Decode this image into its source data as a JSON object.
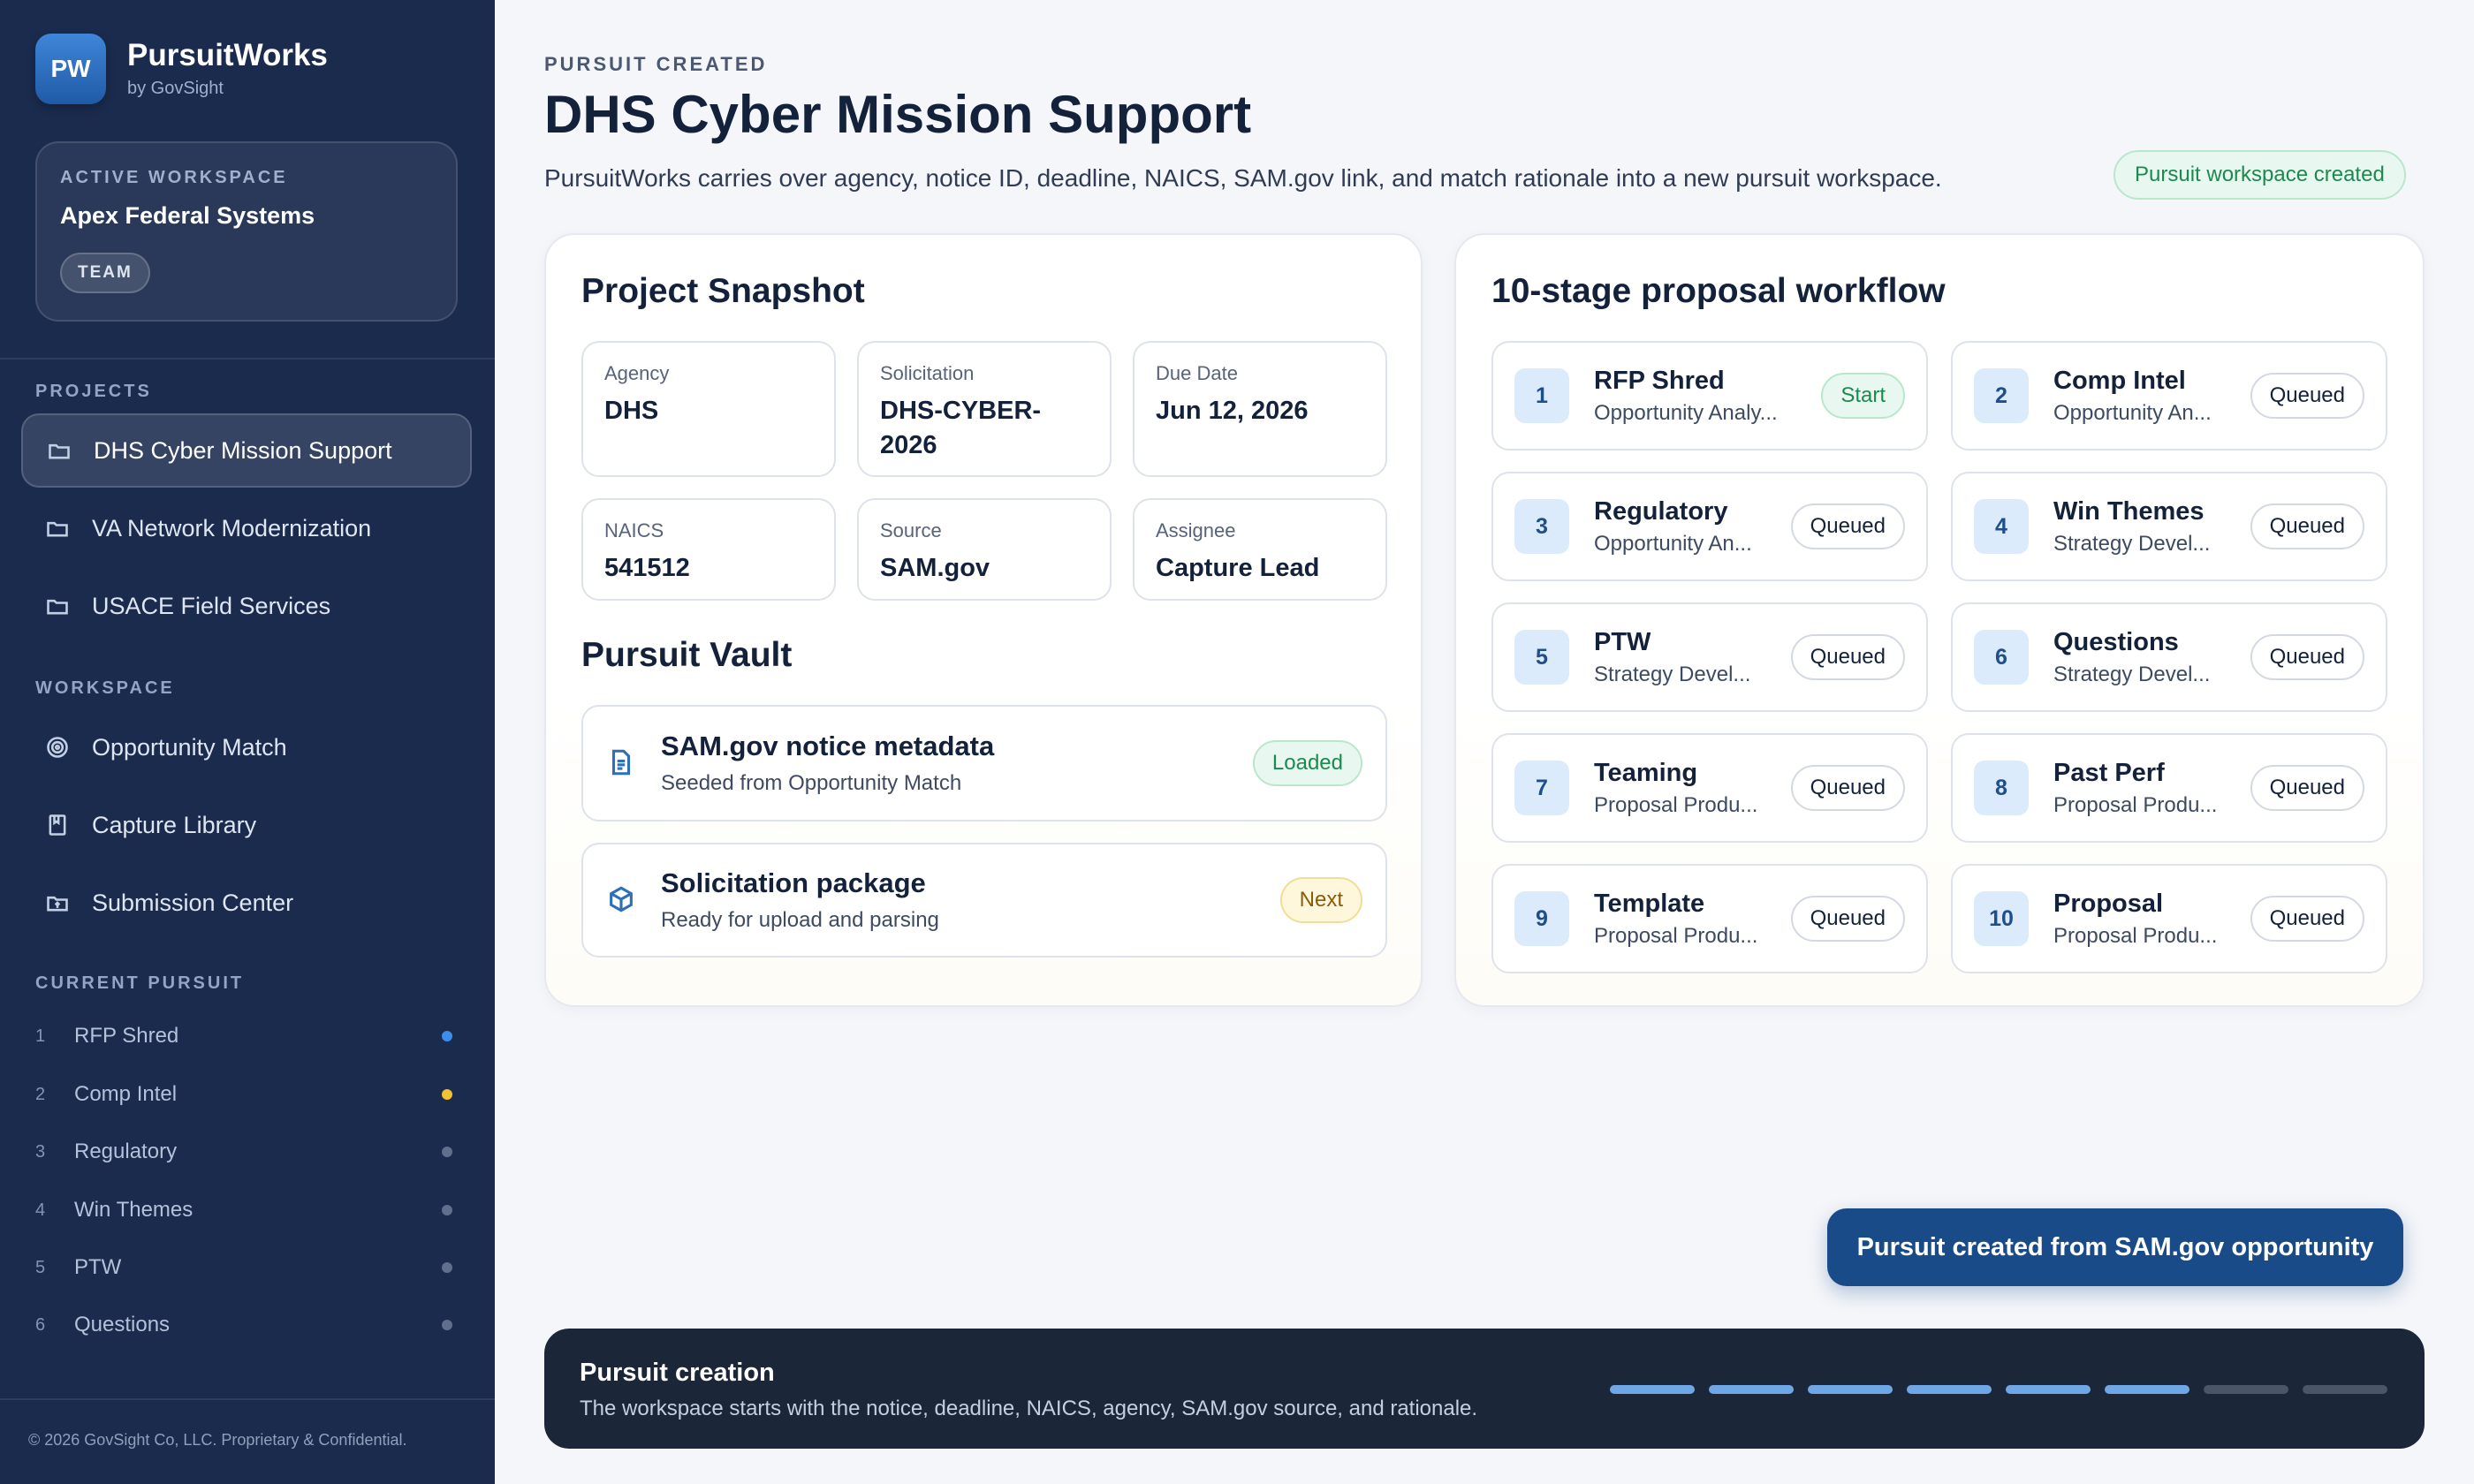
{
  "brand": {
    "logo": "PW",
    "name": "PursuitWorks",
    "sub": "by GovSight"
  },
  "workspace": {
    "label": "ACTIVE WORKSPACE",
    "name": "Apex Federal Systems",
    "badge": "TEAM"
  },
  "sidebar": {
    "projects_label": "PROJECTS",
    "projects": [
      {
        "label": "DHS Cyber Mission Support",
        "icon": "folder-icon",
        "active": true
      },
      {
        "label": "VA Network Modernization",
        "icon": "folder-icon",
        "active": false
      },
      {
        "label": "USACE Field Services",
        "icon": "folder-icon",
        "active": false
      }
    ],
    "workspace_label": "WORKSPACE",
    "workspace_items": [
      {
        "label": "Opportunity Match",
        "icon": "target-icon"
      },
      {
        "label": "Capture Library",
        "icon": "book-icon"
      },
      {
        "label": "Submission Center",
        "icon": "folder-upload-icon"
      }
    ],
    "current_label": "CURRENT PURSUIT",
    "current_stages": [
      {
        "num": "1",
        "name": "RFP Shred",
        "dot": "#3b8fe8"
      },
      {
        "num": "2",
        "name": "Comp Intel",
        "dot": "#f2c230"
      },
      {
        "num": "3",
        "name": "Regulatory",
        "dot": "#5f6f8c"
      },
      {
        "num": "4",
        "name": "Win Themes",
        "dot": "#5f6f8c"
      },
      {
        "num": "5",
        "name": "PTW",
        "dot": "#5f6f8c"
      },
      {
        "num": "6",
        "name": "Questions",
        "dot": "#5f6f8c"
      }
    ],
    "footer": "© 2026 GovSight Co, LLC. Proprietary & Confidential."
  },
  "header": {
    "eyebrow": "PURSUIT CREATED",
    "title": "DHS Cyber Mission Support",
    "description": "PursuitWorks carries over agency, notice ID, deadline, NAICS, SAM.gov link, and match rationale into a new pursuit workspace.",
    "badge": "Pursuit workspace created"
  },
  "snapshot": {
    "title": "Project Snapshot",
    "fields": [
      {
        "label": "Agency",
        "value": "DHS"
      },
      {
        "label": "Solicitation",
        "value": "DHS-CYBER-2026"
      },
      {
        "label": "Due Date",
        "value": "Jun 12, 2026"
      },
      {
        "label": "NAICS",
        "value": "541512"
      },
      {
        "label": "Source",
        "value": "SAM.gov"
      },
      {
        "label": "Assignee",
        "value": "Capture Lead"
      }
    ]
  },
  "vault": {
    "title": "Pursuit Vault",
    "items": [
      {
        "title": "SAM.gov notice metadata",
        "sub": "Seeded from Opportunity Match",
        "status": "Loaded",
        "icon": "document-icon"
      },
      {
        "title": "Solicitation package",
        "sub": "Ready for upload and parsing",
        "status": "Next",
        "icon": "package-icon"
      }
    ]
  },
  "workflow": {
    "title": "10-stage proposal workflow",
    "stages": [
      {
        "num": "1",
        "title": "RFP Shred",
        "sub": "Opportunity Analy...",
        "status": "Start"
      },
      {
        "num": "2",
        "title": "Comp Intel",
        "sub": "Opportunity An...",
        "status": "Queued"
      },
      {
        "num": "3",
        "title": "Regulatory",
        "sub": "Opportunity An...",
        "status": "Queued"
      },
      {
        "num": "4",
        "title": "Win Themes",
        "sub": "Strategy Devel...",
        "status": "Queued"
      },
      {
        "num": "5",
        "title": "PTW",
        "sub": "Strategy Devel...",
        "status": "Queued"
      },
      {
        "num": "6",
        "title": "Questions",
        "sub": "Strategy Devel...",
        "status": "Queued"
      },
      {
        "num": "7",
        "title": "Teaming",
        "sub": "Proposal Produ...",
        "status": "Queued"
      },
      {
        "num": "8",
        "title": "Past Perf",
        "sub": "Proposal Produ...",
        "status": "Queued"
      },
      {
        "num": "9",
        "title": "Template",
        "sub": "Proposal Produ...",
        "status": "Queued"
      },
      {
        "num": "10",
        "title": "Proposal",
        "sub": "Proposal Produ...",
        "status": "Queued"
      }
    ]
  },
  "toast": {
    "label": "Pursuit created from SAM.gov opportunity"
  },
  "bottom": {
    "title": "Pursuit creation",
    "sub": "The workspace starts with the notice, deadline, NAICS, agency, SAM.gov source, and rationale.",
    "progress_total": 8,
    "progress_done": 6
  }
}
